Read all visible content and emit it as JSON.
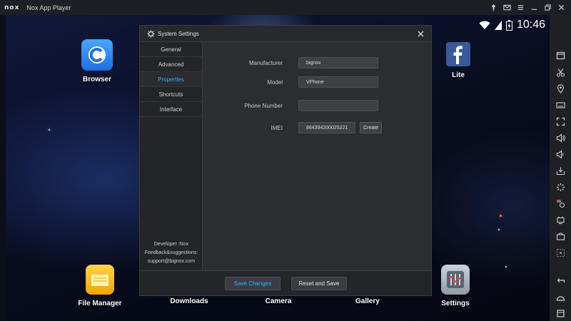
{
  "window": {
    "logo": "nox",
    "title": "Nox App Player",
    "controls": [
      "pin-icon",
      "mail-icon",
      "menu-icon",
      "minimize-icon",
      "restore-icon",
      "close-icon"
    ]
  },
  "status": {
    "time": "10:46",
    "icons": [
      "wifi-icon",
      "signal-icon",
      "battery-icon"
    ]
  },
  "desktop": {
    "apps": [
      {
        "label": "Browser",
        "icon": "browser-icon"
      },
      {
        "label": "Lite",
        "icon": "facebook-icon"
      },
      {
        "label": "File Manager",
        "icon": "folder-icon"
      },
      {
        "label": "Downloads"
      },
      {
        "label": "Camera"
      },
      {
        "label": "Gallery"
      },
      {
        "label": "Settings",
        "icon": "settings-sliders-icon"
      }
    ]
  },
  "dialog": {
    "title": "System Settings",
    "nav": [
      "General",
      "Advanced",
      "Properties",
      "Shortcuts",
      "Interface"
    ],
    "active_nav": "Properties",
    "developer_lines": [
      "Developer :Nox",
      "Feedback&suggestions:",
      "support@bignox.com"
    ],
    "fields": {
      "manufacturer": {
        "label": "Manufacturer",
        "value": "bignox"
      },
      "model": {
        "label": "Model",
        "value": "VPhone"
      },
      "phone": {
        "label": "Phone Number",
        "value": ""
      },
      "imei": {
        "label": "IMEI",
        "value": "864394200025221",
        "action": "Create"
      }
    },
    "buttons": {
      "save": "Save Changes",
      "reset": "Reset and Save"
    }
  },
  "toolbar": {
    "icons": [
      "apk-install-icon",
      "scissors-icon",
      "location-icon",
      "keyboard-icon",
      "fullscreen-icon",
      "volume-up-icon",
      "volume-down-icon",
      "import-icon",
      "loading-icon",
      "multi-instance-icon",
      "macro-icon",
      "screenshot-icon",
      "more-icon",
      "back-icon",
      "home-icon",
      "recent-apps-icon"
    ]
  },
  "colors": {
    "accent": "#3ab0ff",
    "dialog_bg": "#2b2d30",
    "titlebar_bg": "#1d1f24"
  }
}
